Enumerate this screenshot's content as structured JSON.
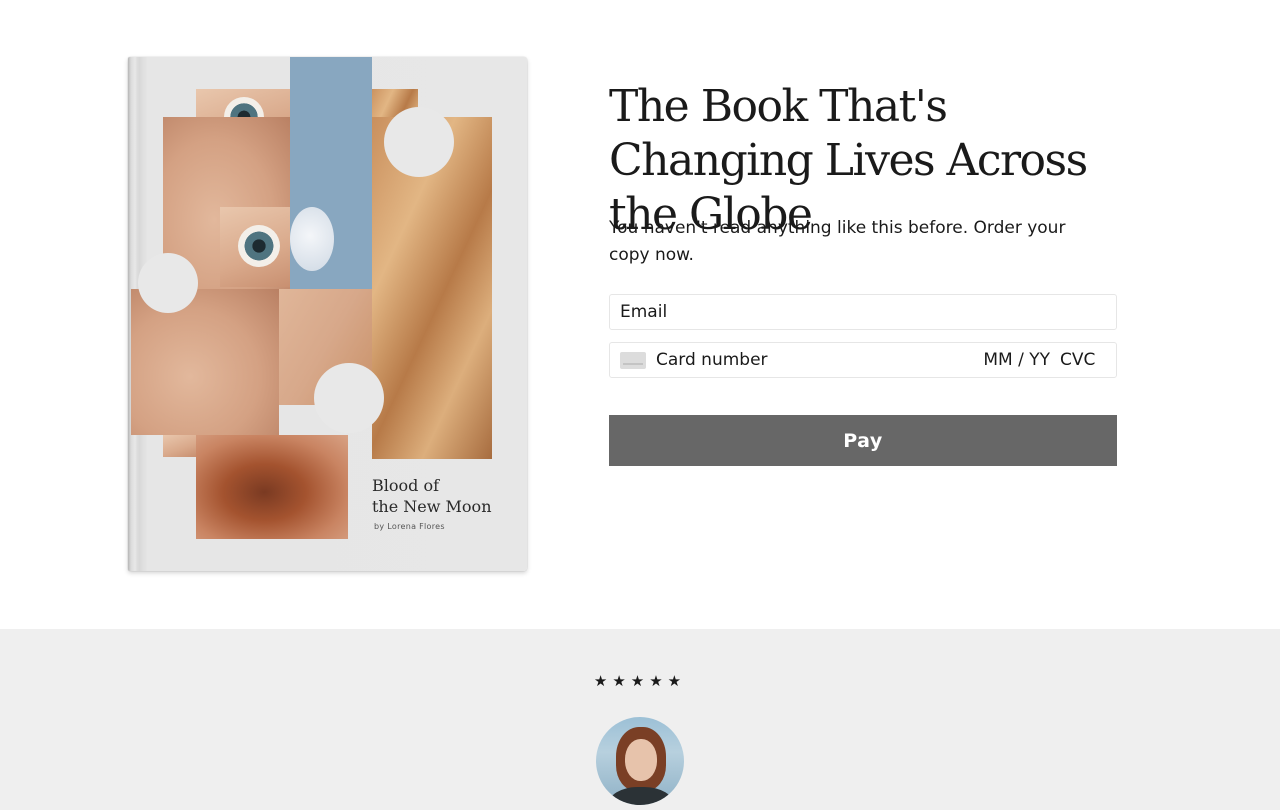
{
  "book": {
    "title_line1": "Blood of",
    "title_line2": "the New Moon",
    "author": "by Lorena Flores"
  },
  "hero": {
    "headline": "The Book That's Changing Lives Across the Globe",
    "subtext": "You haven't read anything like this before. Order your copy now."
  },
  "form": {
    "email_placeholder": "Email",
    "card_icon": "credit-card-icon",
    "card_number_placeholder": "Card number",
    "expiry_placeholder": "MM / YY",
    "cvc_placeholder": "CVC",
    "pay_label": "Pay",
    "pay_color": "#676767"
  },
  "testimonial": {
    "rating": 5,
    "stars": "★★★★★",
    "avatar_icon": "reviewer-avatar"
  }
}
